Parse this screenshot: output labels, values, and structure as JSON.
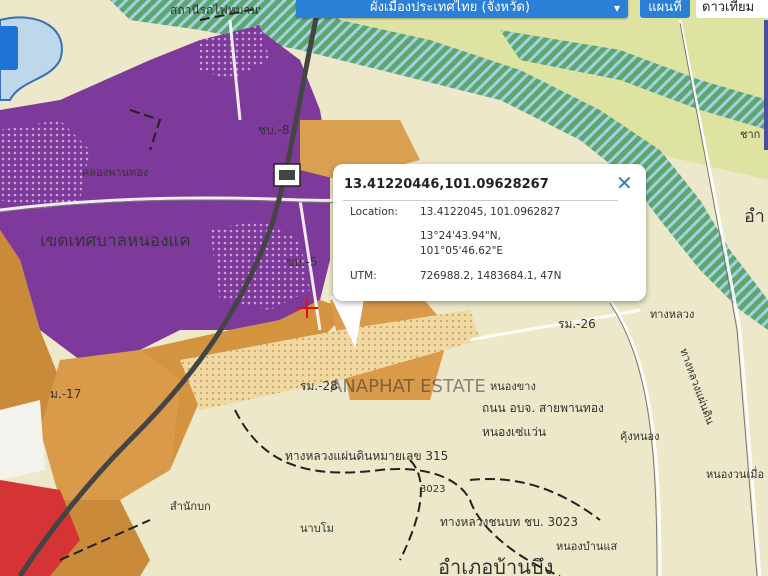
{
  "map": {
    "layer_selector_label": "ผังเมืองประเทศไทย (จังหวัด)",
    "map_button_label": "แผนที่",
    "satellite_button_label": "ดาวเทียม",
    "labels": {
      "top_station": "สถานีรถไฟหมาน",
      "district_hanaklong": "เขตเทศบาลหนองแค",
      "khlong_phanthong": "คลองพานทอง",
      "sopo_8": "ชบ.-8",
      "sopo_5": "ชบ.-5",
      "rom_26": "รม.-26",
      "rom_28": "รม.-28",
      "ngu_17": "ม.-17",
      "nong_chang": "หนองขาง",
      "road_obj": "ถนน อบจ. สายพานทอง",
      "nong_saewan": "หนองเซ่แว่น",
      "highway_315": "ทางหลวงแผ่นดินหมายเลข 315",
      "rural_road_3023": "ทางหลวงชนบท ชบ. 3023",
      "num_3023": "3023",
      "hwy_right": "ทางหลวงแผ่นดิน",
      "district_bottom": "อำเภอบ้านบึง",
      "khung_nong": "คุ้งหนอง",
      "nong_right": "หนองวนเมื่อ",
      "mueang_right": "อำ",
      "sam_nak": "สำนักบก",
      "na_bo": "นาบโม",
      "nong_bottom": "หนองบำนแส",
      "chak": "ชาก",
      "phan_thong_road": "ทางหลวง",
      "watermark": "ANAPHAT ESTATE"
    }
  },
  "popup": {
    "title": "13.41220446,101.09628267",
    "location_label": "Location:",
    "location_value": "13.4122045, 101.0962827",
    "dms_lat": "13°24'43.94\"N,",
    "dms_lon": "101°05'46.62\"E",
    "utm_label": "UTM:",
    "utm_value": "726988.2, 1483684.1, 47N"
  },
  "colors": {
    "purple_zone": "#7e3a9a",
    "orange_zone": "#c98a3a",
    "green_zone": "#4f9a63",
    "rural_zone": "#ece8c9",
    "red_zone": "#d43434",
    "accent_blue": "#2a7fd6"
  }
}
